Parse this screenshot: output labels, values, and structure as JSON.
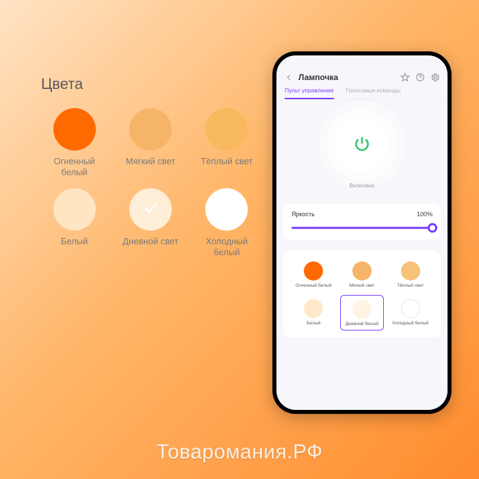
{
  "palette": {
    "title": "Цвета",
    "items": [
      {
        "label": "Огненный\nбелый",
        "color": "#ff6a00"
      },
      {
        "label": "Мягкий свет",
        "color": "#f6b469"
      },
      {
        "label": "Тёплый свет",
        "color": "#f8b85e"
      },
      {
        "label": "Белый",
        "color": "#ffe5c2"
      },
      {
        "label": "Дневной свет",
        "color": "#ffeed8",
        "selected": true
      },
      {
        "label": "Холодный\nбелый",
        "color": "#ffffff"
      }
    ]
  },
  "phone": {
    "status": {
      "time": "",
      "carrier": ""
    },
    "appbar": {
      "title": "Лампочка"
    },
    "tabs": [
      {
        "label": "Пульт управления",
        "active": true
      },
      {
        "label": "Голосовые команды",
        "active": false
      }
    ],
    "power": {
      "state_label": "Включено"
    },
    "brightness": {
      "label": "Яркость",
      "value_text": "100%",
      "value_pct": 100
    },
    "colors": [
      {
        "label": "Огненный белый",
        "color": "#ff6a00"
      },
      {
        "label": "Мягкий свет",
        "color": "#f6b469"
      },
      {
        "label": "Тёплый свет",
        "color": "#f8c27a"
      },
      {
        "label": "Белый",
        "color": "#ffe9cc"
      },
      {
        "label": "Дневной белый",
        "color": "#fff3e4",
        "selected": true
      },
      {
        "label": "Холодный белый",
        "color": "#ffffff"
      }
    ]
  },
  "watermark": "Товаромания.РФ",
  "brand": {
    "accent": "#7a3cff",
    "success": "#39c26d"
  }
}
